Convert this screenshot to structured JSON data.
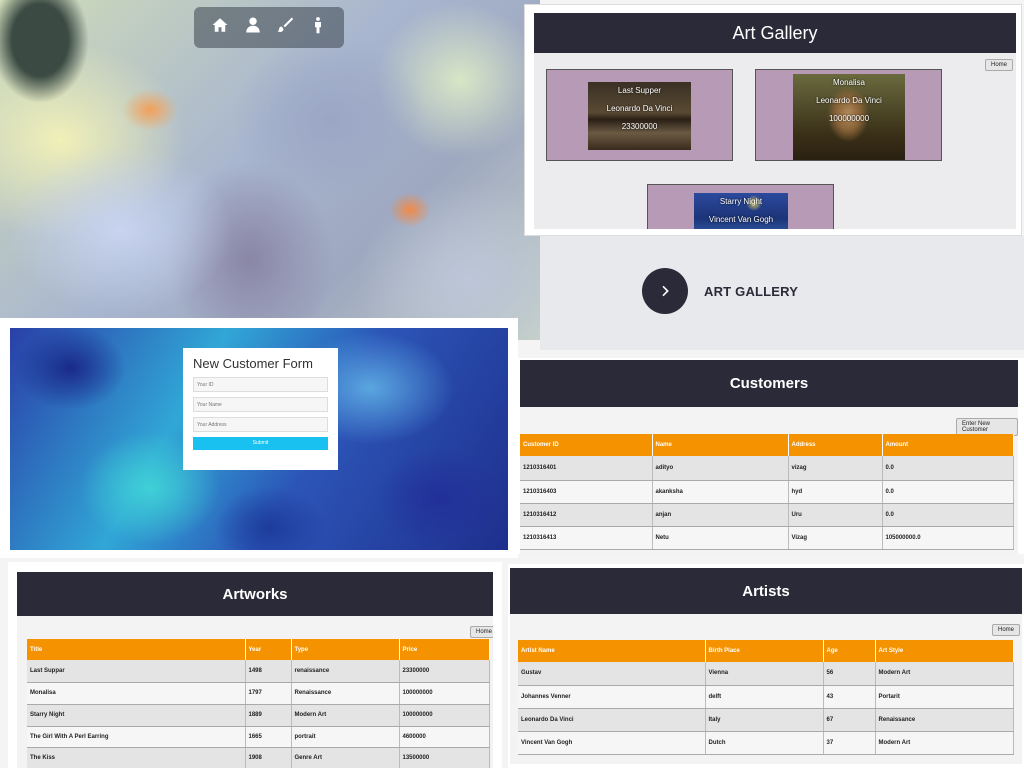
{
  "nav": {
    "icons": [
      "home-icon",
      "user-icon",
      "brush-icon",
      "person-icon"
    ]
  },
  "gallery": {
    "title": "Art Gallery",
    "home_label": "Home",
    "cards": [
      {
        "title": "Last Supper",
        "artist": "Leonardo Da Vinci",
        "price": "23300000"
      },
      {
        "title": "Monalisa",
        "artist": "Leonardo Da Vinci",
        "price": "100000000"
      },
      {
        "title": "Starry Night",
        "artist": "Vincent Van Gogh",
        "price": ""
      }
    ]
  },
  "cta": {
    "label": "ART GALLERY"
  },
  "form": {
    "title": "New Customer Form",
    "id_placeholder": "Your ID",
    "name_placeholder": "Your Name",
    "address_placeholder": "Your Address",
    "submit_label": "Submit"
  },
  "customers": {
    "title": "Customers",
    "button_label": "Enter New Customer",
    "columns": [
      "Customer ID",
      "Name",
      "Address",
      "Amount"
    ],
    "rows": [
      [
        "1210316401",
        "adityo",
        "vizag",
        "0.0"
      ],
      [
        "1210316403",
        "akanksha",
        "hyd",
        "0.0"
      ],
      [
        "1210316412",
        "anjan",
        "Uru",
        "0.0"
      ],
      [
        "1210316413",
        "Netu",
        "Vizag",
        "105000000.0"
      ]
    ]
  },
  "artworks": {
    "title": "Artworks",
    "home_label": "Home",
    "columns": [
      "Title",
      "Year",
      "Type",
      "Price"
    ],
    "rows": [
      [
        "Last Suppar",
        "1498",
        "renaissance",
        "23300000"
      ],
      [
        "Monalisa",
        "1797",
        "Renaissance",
        "100000000"
      ],
      [
        "Starry Night",
        "1889",
        "Modern Art",
        "100000000"
      ],
      [
        "The Girl With A Perl Earring",
        "1665",
        "portrait",
        "4600000"
      ],
      [
        "The Kiss",
        "1908",
        "Genre Art",
        "13500000"
      ]
    ]
  },
  "artists": {
    "title": "Artists",
    "home_label": "Home",
    "columns": [
      "Artist Name",
      "Birth Place",
      "Age",
      "Art Style"
    ],
    "rows": [
      [
        "Gustav",
        "Vienna",
        "56",
        "Modern Art"
      ],
      [
        "Johannes Venner",
        "delft",
        "43",
        "Portarit"
      ],
      [
        "Leonardo Da Vinci",
        "Italy",
        "67",
        "Renaissance"
      ],
      [
        "Vincent Van Gogh",
        "Dutch",
        "37",
        "Modern Art"
      ]
    ]
  }
}
